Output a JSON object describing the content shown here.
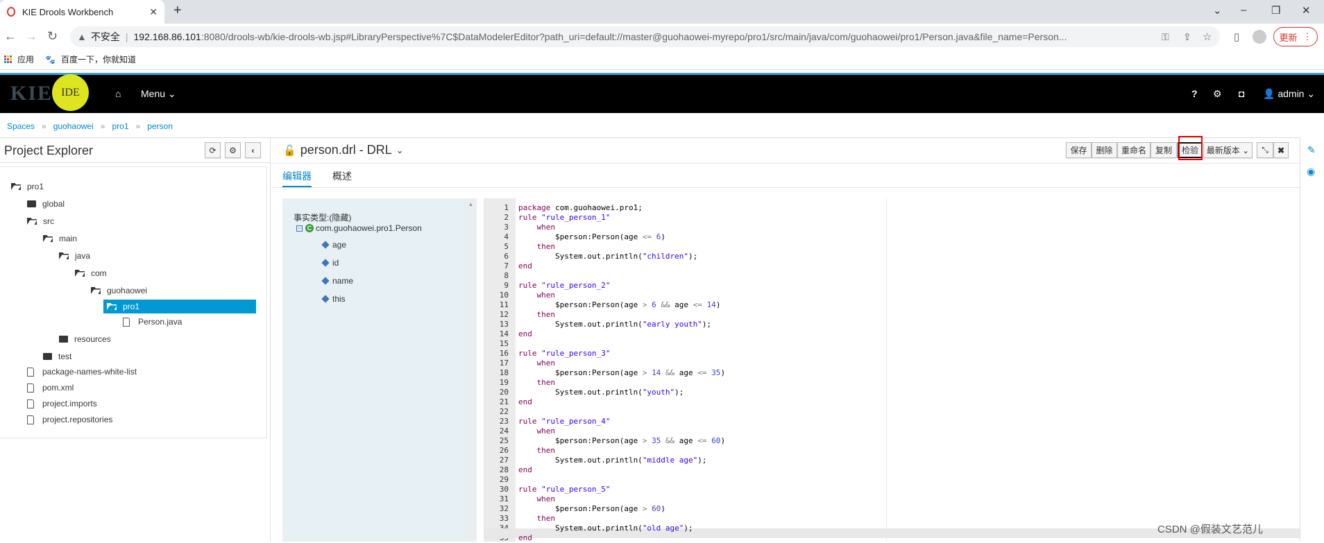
{
  "browser": {
    "tab_title": "KIE Drools Workbench",
    "insecure_label": "不安全",
    "url_host": "192.168.86.101",
    "url_rest": ":8080/drools-wb/kie-drools-wb.jsp#LibraryPerspective%7C$DataModelerEditor?path_uri=default://master@guohaowei-myrepo/pro1/src/main/java/com/guohaowei/pro1/Person.java&file_name=Person...",
    "update_label": "更新",
    "bookmarks": [
      {
        "label": "应用"
      },
      {
        "label": "百度一下，你就知道"
      }
    ]
  },
  "header": {
    "logo_kie": "KIE",
    "logo_ide": "IDE",
    "menu_label": "Menu",
    "help": "?",
    "user": "admin"
  },
  "breadcrumb": [
    "Spaces",
    "guohaowei",
    "pro1",
    "person"
  ],
  "explorer": {
    "title": "Project Explorer",
    "tree": [
      {
        "label": "pro1",
        "depth": 0,
        "icon": "folder-open"
      },
      {
        "label": "global",
        "depth": 1,
        "icon": "folder"
      },
      {
        "label": "src",
        "depth": 1,
        "icon": "folder-open"
      },
      {
        "label": "main",
        "depth": 2,
        "icon": "folder-open"
      },
      {
        "label": "java",
        "depth": 3,
        "icon": "folder-open"
      },
      {
        "label": "com",
        "depth": 4,
        "icon": "folder-open"
      },
      {
        "label": "guohaowei",
        "depth": 5,
        "icon": "folder-open"
      },
      {
        "label": "pro1",
        "depth": 6,
        "icon": "folder-open",
        "selected": true
      },
      {
        "label": "Person.java",
        "depth": 7,
        "icon": "file"
      },
      {
        "label": "resources",
        "depth": 3,
        "icon": "folder"
      },
      {
        "label": "test",
        "depth": 2,
        "icon": "folder"
      },
      {
        "label": "package-names-white-list",
        "depth": 1,
        "icon": "file"
      },
      {
        "label": "pom.xml",
        "depth": 1,
        "icon": "file"
      },
      {
        "label": "project.imports",
        "depth": 1,
        "icon": "file"
      },
      {
        "label": "project.repositories",
        "depth": 1,
        "icon": "file"
      }
    ]
  },
  "editor": {
    "title": "person.drl - DRL",
    "toolbar": [
      "保存",
      "删除",
      "重命名",
      "复制",
      "检验",
      "最新版本"
    ],
    "tabs": [
      "编辑器",
      "概述"
    ],
    "facts": {
      "header": "事实类型:(隐藏)",
      "class": "com.guohaowei.pro1.Person",
      "fields": [
        "age",
        "id",
        "name",
        "this"
      ]
    },
    "code": [
      "package com.guohaowei.pro1;",
      "rule \"rule_person_1\"",
      "    when",
      "        $person:Person(age <= 6)",
      "    then",
      "        System.out.println(\"children\");",
      "end",
      "",
      "rule \"rule_person_2\"",
      "    when",
      "        $person:Person(age > 6 && age <= 14)",
      "    then",
      "        System.out.println(\"early youth\");",
      "end",
      "",
      "rule \"rule_person_3\"",
      "    when",
      "        $person:Person(age > 14 && age <= 35)",
      "    then",
      "        System.out.println(\"youth\");",
      "end",
      "",
      "rule \"rule_person_4\"",
      "    when",
      "        $person:Person(age > 35 && age <= 60)",
      "    then",
      "        System.out.println(\"middle age\");",
      "end",
      "",
      "rule \"rule_person_5\"",
      "    when",
      "        $person:Person(age > 60)",
      "    then",
      "        System.out.println(\"old age\");",
      "end"
    ]
  },
  "watermark": "CSDN @假装文艺范儿",
  "colors": {
    "accent": "#0088ce",
    "selected": "#0099d3",
    "highlight_box": "#ee0000"
  }
}
